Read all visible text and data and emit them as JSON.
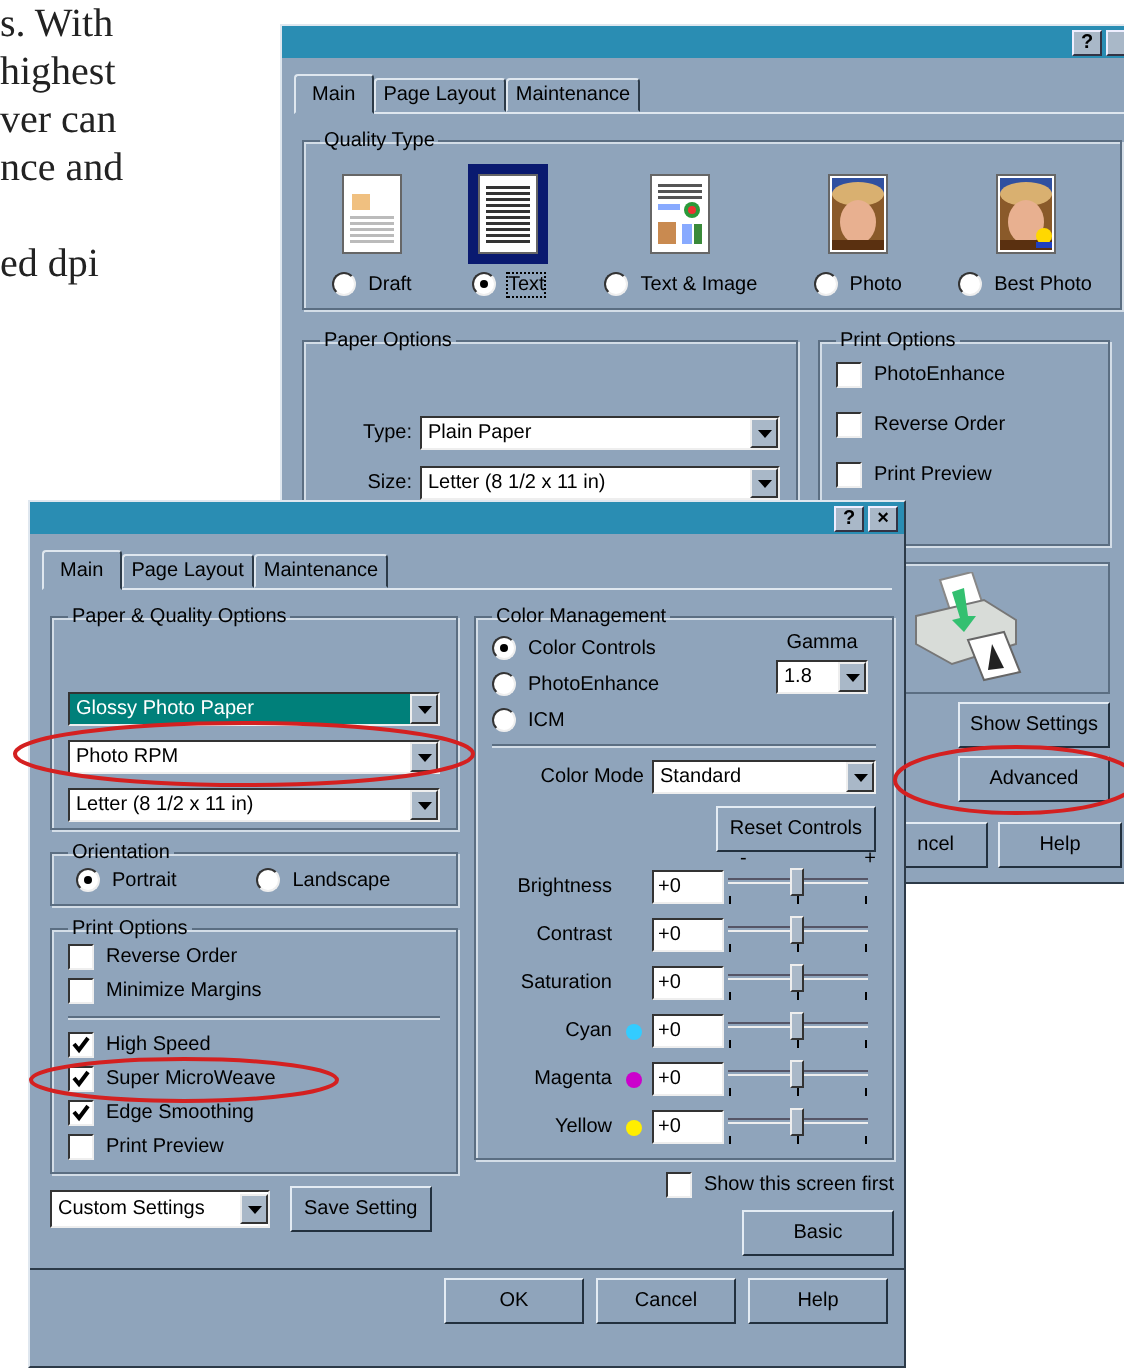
{
  "document_text": {
    "paragraphs": [
      {
        "lines": [
          "s. With",
          "highest",
          "ver can",
          "nce and"
        ]
      },
      {
        "lines": [
          "ed dpi"
        ]
      }
    ]
  },
  "back_window": {
    "title_buttons": [
      "?"
    ],
    "tabs": [
      {
        "label": "Main",
        "selected": true
      },
      {
        "label": "Page Layout",
        "selected": false
      },
      {
        "label": "Maintenance",
        "selected": false
      }
    ],
    "quality_type": {
      "title": "Quality Type",
      "options": [
        {
          "label": "Draft",
          "kind": "draft",
          "selected": false
        },
        {
          "label": "Text",
          "kind": "text",
          "selected": true
        },
        {
          "label": "Text & Image",
          "kind": "text_image",
          "selected": false
        },
        {
          "label": "Photo",
          "selected": false
        },
        {
          "label": "Best Photo",
          "kind": "best_photo",
          "selected": false
        }
      ]
    },
    "paper_options": {
      "title": "Paper Options",
      "fields": [
        {
          "label": "Type:",
          "value": "Plain Paper"
        },
        {
          "label": "Size:",
          "value": "Letter (8 1/2 x 11 in)"
        }
      ]
    },
    "print_options": {
      "title": "Print Options",
      "checkboxes": [
        {
          "label": "PhotoEnhance",
          "checked": false
        },
        {
          "label": "Reverse Order",
          "checked": false
        },
        {
          "label": "Print Preview",
          "checked": false
        }
      ]
    },
    "side_buttons": [
      "Show Settings",
      "Advanced"
    ],
    "bottom_buttons": [
      "ncel",
      "Help"
    ]
  },
  "front_window": {
    "title_buttons": [
      "?",
      "×"
    ],
    "tabs": [
      {
        "label": "Main",
        "selected": true
      },
      {
        "label": "Page Layout",
        "selected": false
      },
      {
        "label": "Maintenance",
        "selected": false
      }
    ],
    "paper_quality": {
      "title": "Paper & Quality Options",
      "selects": [
        {
          "value": "Glossy Photo Paper",
          "highlighted": true
        },
        {
          "value": "Photo RPM",
          "highlighted": false
        },
        {
          "value": "Letter (8 1/2 x 11 in)",
          "highlighted": false
        }
      ]
    },
    "orientation": {
      "title": "Orientation",
      "options": [
        {
          "label": "Portrait",
          "selected": true
        },
        {
          "label": "Landscape",
          "selected": false
        }
      ]
    },
    "print_options": {
      "title": "Print Options",
      "groups": [
        {
          "checkboxes": [
            {
              "label": "Reverse Order",
              "checked": false
            },
            {
              "label": "Minimize Margins",
              "checked": false
            }
          ]
        },
        {
          "checkboxes": [
            {
              "label": "High Speed",
              "checked": true
            },
            {
              "label": "Super MicroWeave",
              "checked": true
            },
            {
              "label": "Edge Smoothing",
              "checked": true
            },
            {
              "label": "Print Preview",
              "checked": false
            }
          ]
        }
      ]
    },
    "preset": {
      "value": "Custom Settings"
    },
    "save_button": "Save Setting",
    "color_management": {
      "title": "Color Management",
      "modes": [
        {
          "label": "Color Controls",
          "selected": true
        },
        {
          "label": "PhotoEnhance",
          "selected": false
        },
        {
          "label": "ICM",
          "selected": false
        }
      ],
      "gamma": {
        "label": "Gamma",
        "value": "1.8"
      },
      "color_mode": {
        "label": "Color Mode",
        "value": "Standard"
      },
      "reset_button": "Reset Controls",
      "scale_min": "-",
      "scale_max": "+",
      "sliders": [
        {
          "label": "Brightness",
          "value": "+0",
          "level": 0.5
        },
        {
          "label": "Contrast",
          "value": "+0",
          "level": 0.5
        },
        {
          "label": "Saturation",
          "value": "+0",
          "level": 0.5
        },
        {
          "label": "Cyan",
          "value": "+0",
          "level": 0.5,
          "color": "#33ccff"
        },
        {
          "label": "Magenta",
          "value": "+0",
          "level": 0.5,
          "color": "#cc00cc"
        },
        {
          "label": "Yellow",
          "value": "+0",
          "level": 0.5,
          "color": "#ffee00"
        }
      ]
    },
    "show_first": {
      "label": "Show this screen first",
      "checked": false
    },
    "basic_button": "Basic",
    "buttons": [
      "OK",
      "Cancel",
      "Help"
    ]
  }
}
